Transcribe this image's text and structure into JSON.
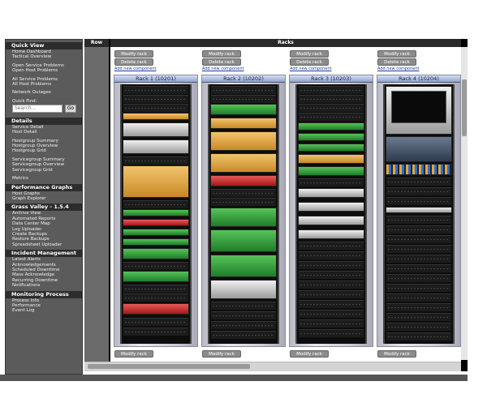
{
  "sidebar": {
    "quick_view": {
      "title": "Quick View",
      "links": [
        "Home Dashboard",
        "Tactical Overview",
        "Open Service Problems",
        "Open Host Problems",
        "All Service Problems",
        "All Host Problems",
        "Network Outages"
      ],
      "quick_find_label": "Quick Find:",
      "search_placeholder": "Search...",
      "go_label": "Go"
    },
    "details": {
      "title": "Details",
      "links": [
        "Service Detail",
        "Host Detail",
        "Hostgroup Summary",
        "Hostgroup Overview",
        "Hostgroup Grid",
        "Servicegroup Summary",
        "Servicegroup Overview",
        "Servicegroup Grid",
        "Metrics"
      ]
    },
    "performance_graphs": {
      "title": "Performance Graphs",
      "links": [
        "Host Graphs",
        "Graph Explorer"
      ]
    },
    "grass_valley": {
      "title": "Grass Valley - 1.5.4",
      "links": [
        "Archive View",
        "Automated Reports",
        "Data Center Map",
        "Log Uploader",
        "Create Backups",
        "Restore Backups",
        "Spreadsheet Uploader"
      ]
    },
    "incident_management": {
      "title": "Incident Management",
      "links": [
        "Latest Alerts",
        "Acknowledgements",
        "Scheduled Downtime",
        "Mass Acknowledge",
        "Recurring Downtime",
        "Notifications"
      ]
    },
    "monitoring_process": {
      "title": "Monitoring Process",
      "links": [
        "Process Info",
        "Performance",
        "Event Log"
      ]
    }
  },
  "main": {
    "row_header": "Row",
    "racks_header": "Racks",
    "modify_label": "Modify rack",
    "delete_label": "Delete rack",
    "add_label": "Add new component",
    "racks": [
      {
        "title": "Rack 1 (10201)"
      },
      {
        "title": "Rack 2 (10202)"
      },
      {
        "title": "Rack 3 (10203)"
      },
      {
        "title": "Rack 4 (10204)"
      }
    ]
  },
  "colors": {
    "accent_orange": "#e0a640",
    "accent_green": "#3aa83f",
    "alert_red": "#c82828",
    "sidebar_bg": "#5b5b5b"
  }
}
